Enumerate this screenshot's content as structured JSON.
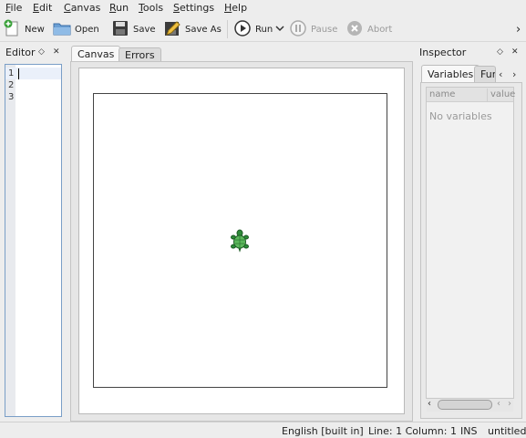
{
  "menu": [
    {
      "key": "F",
      "rest": "ile"
    },
    {
      "key": "E",
      "rest": "dit"
    },
    {
      "key": "C",
      "rest": "anvas"
    },
    {
      "key": "R",
      "rest": "un"
    },
    {
      "key": "T",
      "rest": "ools"
    },
    {
      "key": "S",
      "rest": "ettings"
    },
    {
      "key": "H",
      "rest": "elp"
    }
  ],
  "toolbar": {
    "new": "New",
    "open": "Open",
    "save": "Save",
    "save_as": "Save As",
    "run": "Run",
    "pause": "Pause",
    "abort": "Abort",
    "overflow": "›"
  },
  "editor": {
    "title": "Editor",
    "lines": [
      "1",
      "2",
      "3"
    ]
  },
  "tabs": {
    "canvas": "Canvas",
    "errors": "Errors"
  },
  "inspector": {
    "title": "Inspector",
    "tab_variables": "Variables",
    "tab_functions": "Fur",
    "col_name": "name",
    "col_value": "value",
    "empty": "No variables"
  },
  "status": {
    "language": "English [built in]",
    "position": "Line: 1 Column: 1",
    "mode": "INS",
    "file": "untitled"
  },
  "colors": {
    "turtle_body": "#2e8b3a",
    "turtle_shell": "#5cb85c"
  }
}
